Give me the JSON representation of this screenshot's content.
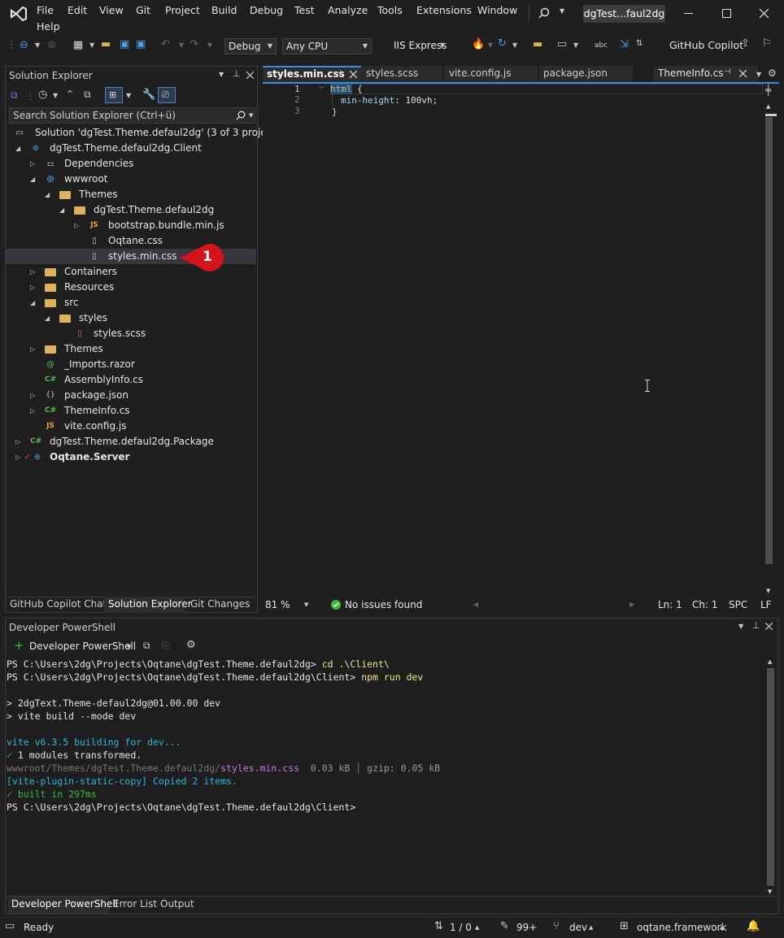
{
  "menu": {
    "items": [
      "File",
      "Edit",
      "View",
      "Git",
      "Project",
      "Build",
      "Debug",
      "Test",
      "Analyze",
      "Tools",
      "Extensions",
      "Window",
      "Help"
    ],
    "title_badge": "dgTest...faul2dg"
  },
  "toolbar": {
    "config": "Debug",
    "platform": "Any CPU",
    "run_target": "IIS Express",
    "copilot": "GitHub Copilot"
  },
  "solution_explorer": {
    "title": "Solution Explorer",
    "search_placeholder": "Search Solution Explorer (Ctrl+ü)",
    "items": [
      {
        "label": "Solution 'dgTest.Theme.defaul2dg' (3 of 3 projects)"
      },
      {
        "label": "dgTest.Theme.defaul2dg.Client"
      },
      {
        "label": "Dependencies"
      },
      {
        "label": "wwwroot"
      },
      {
        "label": "Themes"
      },
      {
        "label": "dgTest.Theme.defaul2dg"
      },
      {
        "label": "bootstrap.bundle.min.js"
      },
      {
        "label": "Oqtane.css"
      },
      {
        "label": "styles.min.css"
      },
      {
        "label": "Containers"
      },
      {
        "label": "Resources"
      },
      {
        "label": "src"
      },
      {
        "label": "styles"
      },
      {
        "label": "styles.scss"
      },
      {
        "label": "Themes"
      },
      {
        "label": "_Imports.razor"
      },
      {
        "label": "AssemblyInfo.cs"
      },
      {
        "label": "package.json"
      },
      {
        "label": "ThemeInfo.cs"
      },
      {
        "label": "vite.config.js"
      },
      {
        "label": "dgTest.Theme.defaul2dg.Package"
      },
      {
        "label": "Oqtane.Server"
      }
    ],
    "callout": "1",
    "bottom_tabs": [
      "GitHub Copilot Chat",
      "Solution Explorer",
      "Git Changes"
    ]
  },
  "editor": {
    "tabs": [
      "styles.min.css",
      "styles.scss",
      "vite.config.js",
      "package.json",
      "ThemeInfo.cs"
    ],
    "lines": [
      {
        "num": "1",
        "selector": "html",
        "brace": " {"
      },
      {
        "num": "2",
        "prop": "min-height",
        "val": " 100vh;"
      },
      {
        "num": "3",
        "brace": "}"
      }
    ],
    "status": {
      "zoom": "81 %",
      "issues": "No issues found",
      "ln": "Ln: 1",
      "ch": "Ch: 1",
      "spc": "SPC",
      "lf": "LF"
    }
  },
  "terminal": {
    "title": "Developer PowerShell",
    "dropdown": "Developer PowerShell",
    "lines": [
      {
        "prompt": "PS C:\\Users\\2dg\\Projects\\Oqtane\\dgTest.Theme.defaul2dg> ",
        "cmd": "cd .\\Client\\"
      },
      {
        "prompt": "PS C:\\Users\\2dg\\Projects\\Oqtane\\dgTest.Theme.defaul2dg\\Client> ",
        "cmd": "npm run dev"
      },
      {
        "text": "> 2dgText.Theme-defaul2dg@01.00.00 dev"
      },
      {
        "text": "> vite build --mode dev"
      },
      {
        "vite": "vite v6.3.5 building for dev..."
      },
      {
        "check": "✓",
        "text": " 1 modules transformed."
      },
      {
        "path": "wwwroot/Themes/dgTest.Theme.defaul2dg/",
        "file": "styles.min.css",
        "size": "  0.03 kB ",
        "sep": "│",
        "gzip": " gzip: 0.05 kB"
      },
      {
        "plugin": "[vite-plugin-static-copy] Copied 2 items."
      },
      {
        "built": "✓ built in 297ms"
      },
      {
        "prompt": "PS C:\\Users\\2dg\\Projects\\Oqtane\\dgTest.Theme.defaul2dg\\Client>"
      }
    ],
    "bottom_tabs": [
      "Developer PowerShell",
      "Error List",
      "Output"
    ]
  },
  "statusbar": {
    "ready": "Ready",
    "lines": "1 / 0",
    "changes": "99+",
    "branch": "dev",
    "repo": "oqtane.framework"
  }
}
